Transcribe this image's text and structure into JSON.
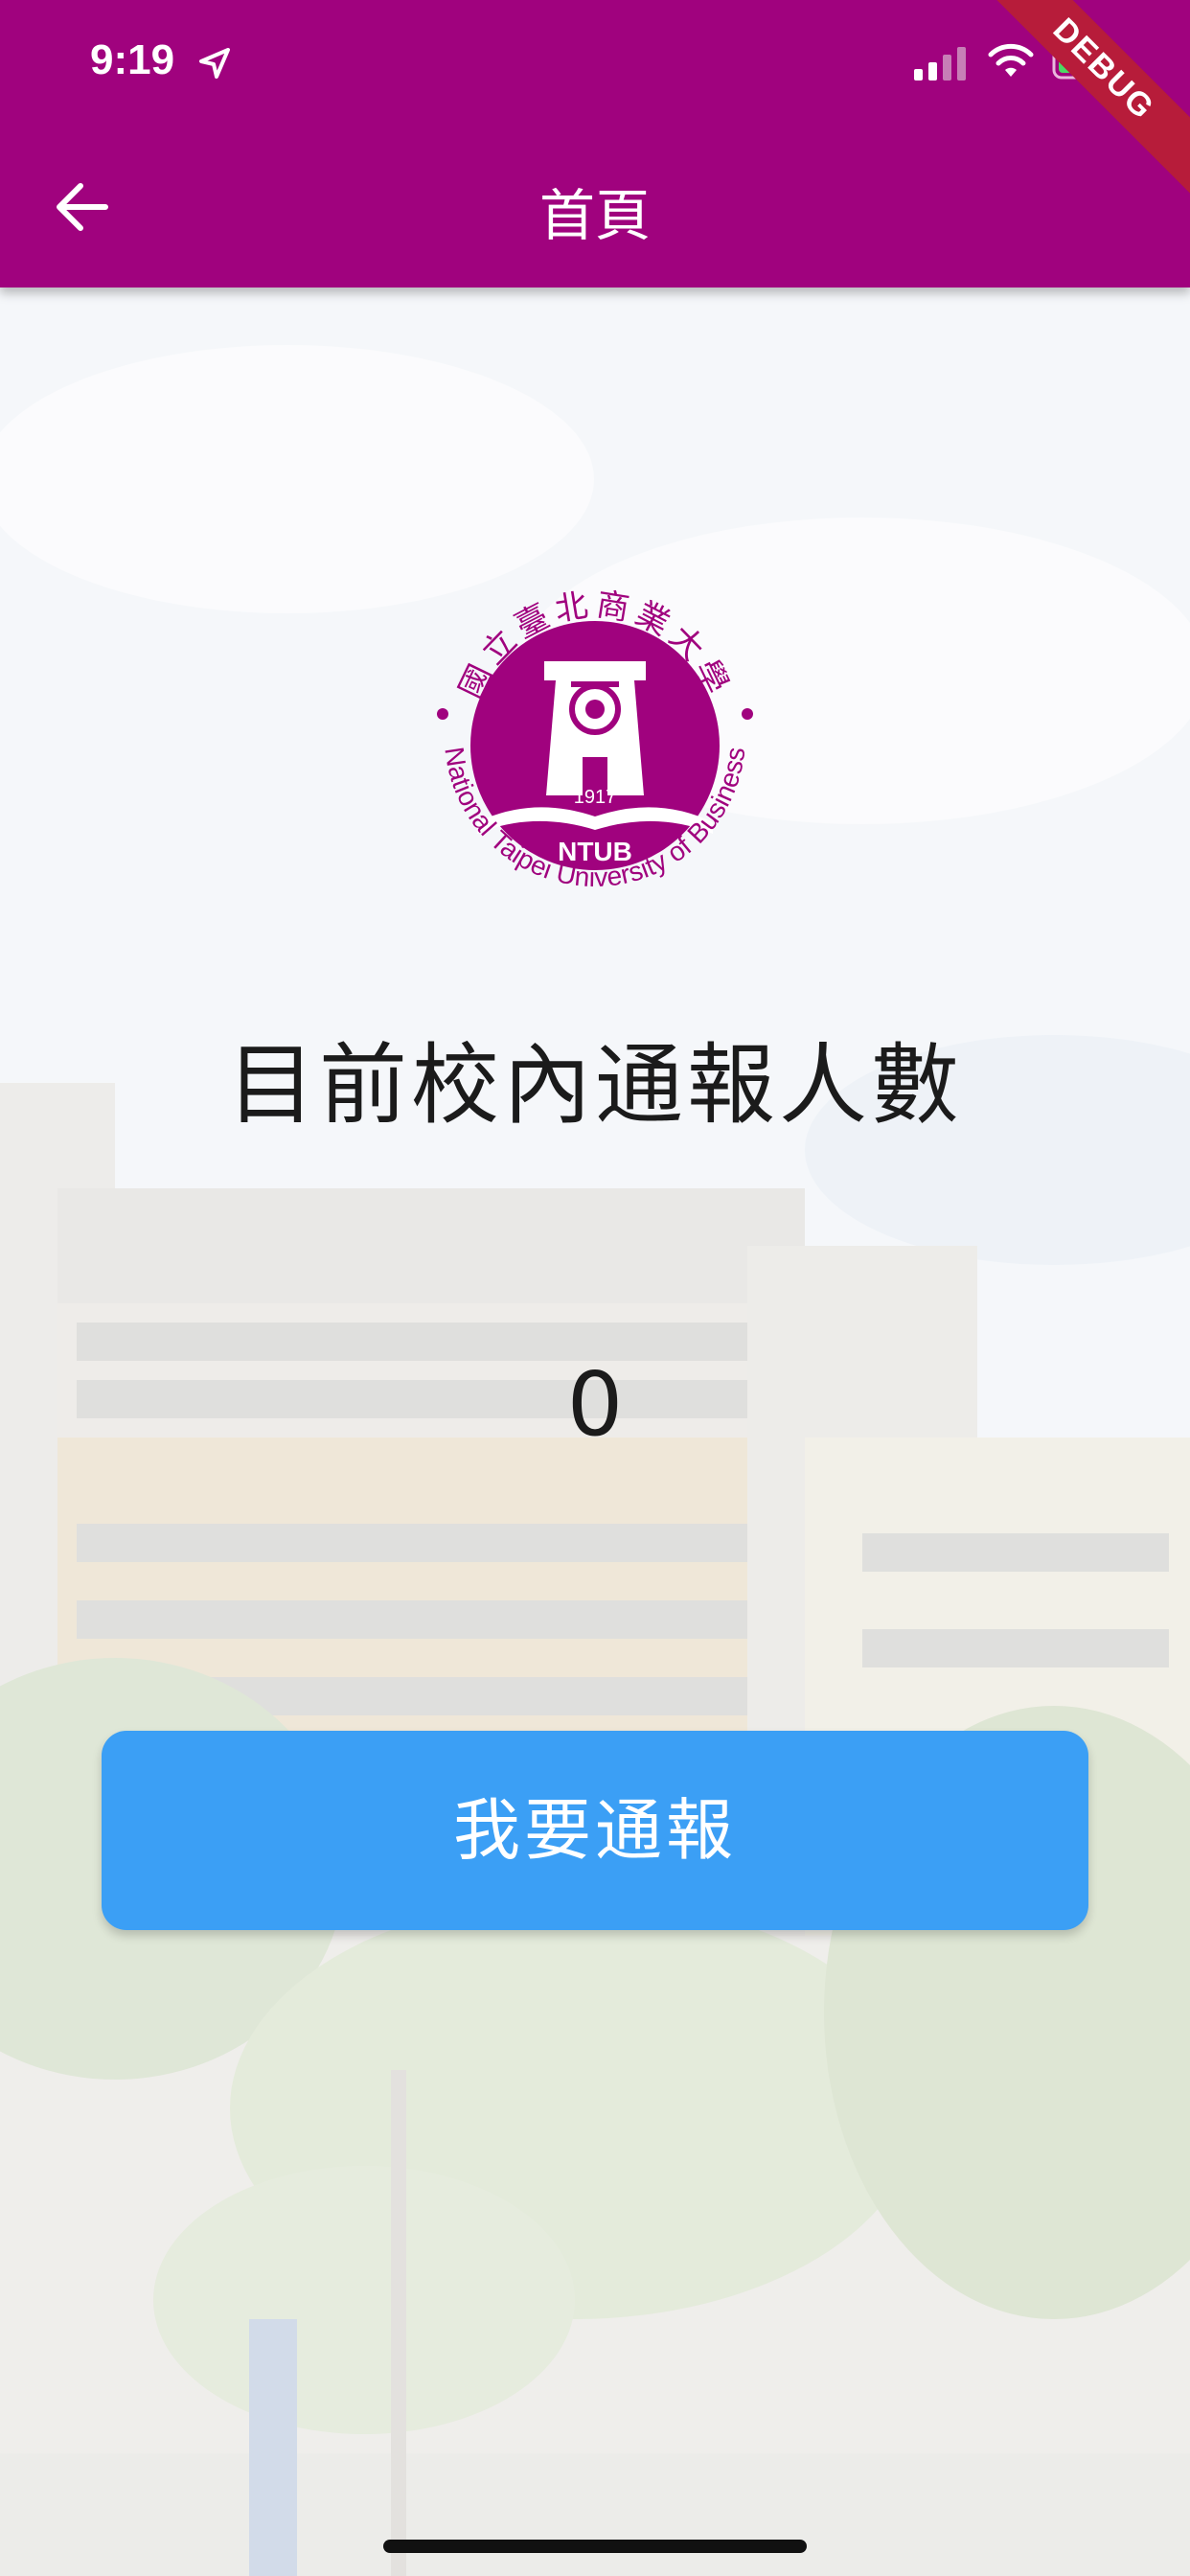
{
  "status_bar": {
    "time": "9:19"
  },
  "app_bar": {
    "title": "首頁",
    "debug_label": "DEBUG"
  },
  "logo": {
    "chinese_name": "國立臺北商業大學",
    "english_name": "National Taipei University of Business",
    "year": "1917",
    "abbr": "NTUB"
  },
  "main": {
    "heading": "目前校內通報人數",
    "count": "0",
    "report_button_label": "我要通報"
  },
  "colors": {
    "app_bar": "#a0027e",
    "logo": "#a0027e",
    "button": "#3b9ff5"
  },
  "icons": [
    "location-arrow-icon",
    "signal-icon",
    "wifi-icon",
    "battery-charging-icon",
    "back-arrow-icon"
  ]
}
